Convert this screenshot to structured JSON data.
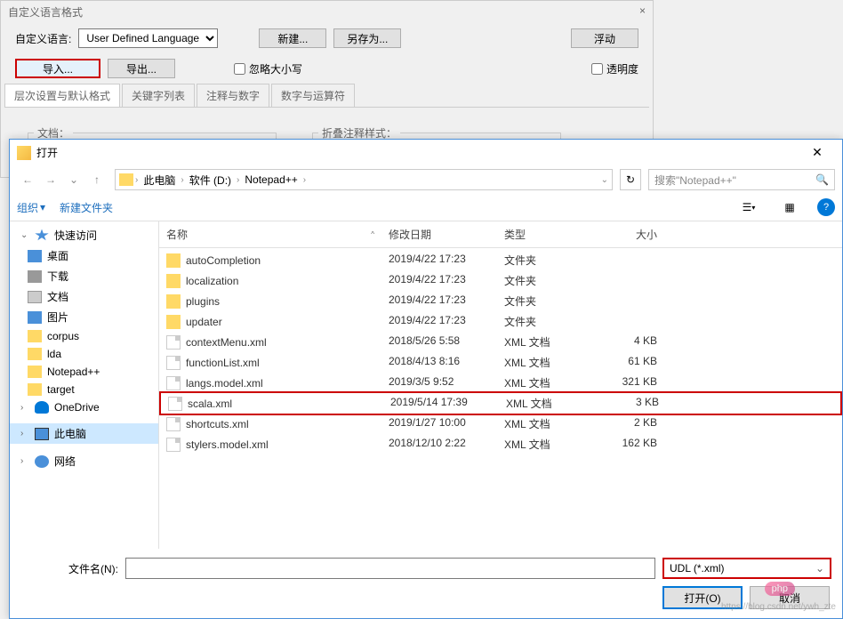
{
  "udl": {
    "title": "自定义语言格式",
    "lang_label": "自定义语言:",
    "lang_value": "User Defined Language",
    "btn_new": "新建...",
    "btn_saveas": "另存为...",
    "btn_float": "浮动",
    "btn_import": "导入...",
    "btn_export": "导出...",
    "chk_ignorecase": "忽略大小写",
    "chk_transparent": "透明度",
    "tabs": [
      "层次设置与默认格式",
      "关键字列表",
      "注释与数字",
      "数字与运算符"
    ],
    "fieldset_doc": "文档：",
    "fieldset_fold": "折叠注释样式："
  },
  "fd": {
    "title": "打开",
    "breadcrumb": [
      "此电脑",
      "软件 (D:)",
      "Notepad++"
    ],
    "search_placeholder": "搜索\"Notepad++\"",
    "toolbar_organize": "组织",
    "toolbar_newfolder": "新建文件夹",
    "sidebar": [
      {
        "label": "快速访问",
        "icon": "star",
        "header": true,
        "chevron": "⌄"
      },
      {
        "label": "桌面",
        "icon": "desktop"
      },
      {
        "label": "下载",
        "icon": "download"
      },
      {
        "label": "文档",
        "icon": "doc"
      },
      {
        "label": "图片",
        "icon": "pic"
      },
      {
        "label": "corpus",
        "icon": "folder"
      },
      {
        "label": "lda",
        "icon": "folder"
      },
      {
        "label": "Notepad++",
        "icon": "folder"
      },
      {
        "label": "target",
        "icon": "folder"
      },
      {
        "label": "OneDrive",
        "icon": "onedrive",
        "header": true,
        "chevron": "›"
      },
      {
        "label": "此电脑",
        "icon": "pc",
        "header": true,
        "chevron": "›",
        "selected": true
      },
      {
        "label": "网络",
        "icon": "net",
        "header": true,
        "chevron": "›"
      }
    ],
    "columns": {
      "name": "名称",
      "date": "修改日期",
      "type": "类型",
      "size": "大小"
    },
    "rows": [
      {
        "name": "autoCompletion",
        "date": "2019/4/22 17:23",
        "type": "文件夹",
        "size": "",
        "icon": "folder"
      },
      {
        "name": "localization",
        "date": "2019/4/22 17:23",
        "type": "文件夹",
        "size": "",
        "icon": "folder"
      },
      {
        "name": "plugins",
        "date": "2019/4/22 17:23",
        "type": "文件夹",
        "size": "",
        "icon": "folder"
      },
      {
        "name": "updater",
        "date": "2019/4/22 17:23",
        "type": "文件夹",
        "size": "",
        "icon": "folder"
      },
      {
        "name": "contextMenu.xml",
        "date": "2018/5/26 5:58",
        "type": "XML 文档",
        "size": "4 KB",
        "icon": "file"
      },
      {
        "name": "functionList.xml",
        "date": "2018/4/13 8:16",
        "type": "XML 文档",
        "size": "61 KB",
        "icon": "file"
      },
      {
        "name": "langs.model.xml",
        "date": "2019/3/5 9:52",
        "type": "XML 文档",
        "size": "321 KB",
        "icon": "file"
      },
      {
        "name": "scala.xml",
        "date": "2019/5/14 17:39",
        "type": "XML 文档",
        "size": "3 KB",
        "icon": "file",
        "highlighted": true
      },
      {
        "name": "shortcuts.xml",
        "date": "2019/1/27 10:00",
        "type": "XML 文档",
        "size": "2 KB",
        "icon": "file"
      },
      {
        "name": "stylers.model.xml",
        "date": "2018/12/10 2:22",
        "type": "XML 文档",
        "size": "162 KB",
        "icon": "file"
      }
    ],
    "filename_label": "文件名(N):",
    "filename_value": "",
    "filter_value": "UDL (*.xml)",
    "btn_open": "打开(O)",
    "btn_cancel": "取消"
  },
  "watermark": "https://blog.csdn.net/ywh_zte",
  "php_badge": "php"
}
